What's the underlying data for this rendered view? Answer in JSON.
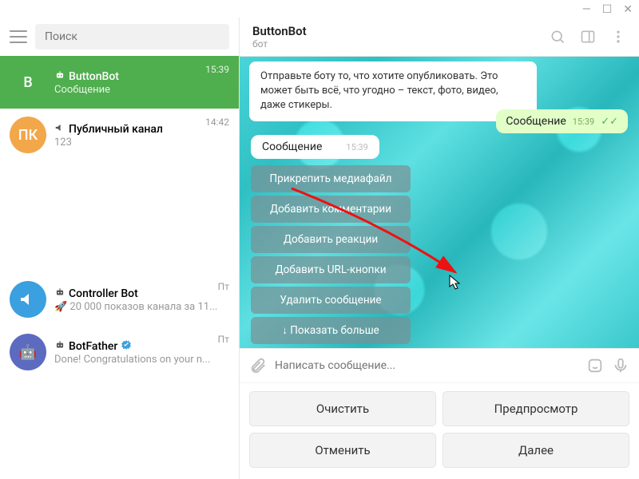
{
  "window": {
    "min": "—",
    "max": "☐",
    "close": "✕"
  },
  "search": {
    "placeholder": "Поиск"
  },
  "chats": [
    {
      "avatar": "В",
      "avatarColor": "#4fae4e",
      "name": "ButtonBot",
      "sub": "Сообщение",
      "time": "15:39",
      "active": true,
      "bot": true
    },
    {
      "avatar": "ПК",
      "avatarColor": "#f2a74b",
      "name": "Публичный канал",
      "sub": "123",
      "time": "14:42",
      "active": false,
      "channel": true
    },
    {
      "avatar": "📣",
      "avatarColor": "#3aa0e0",
      "name": "Controller Bot",
      "sub": "🚀 20 000 показов канала за 11...",
      "time": "Пт",
      "active": false,
      "bot": true
    },
    {
      "avatar": "👤",
      "avatarColor": "#5c6bc0",
      "name": "BotFather",
      "sub": "Done! Congratulations on your n...",
      "time": "Пт",
      "active": false,
      "bot": true,
      "verified": true
    }
  ],
  "header": {
    "title": "ButtonBot",
    "sub": "бот"
  },
  "intro": "Отправьте боту то, что хотите опубликовать. Это может быть всё, что угодно – текст, фото, видео, даже стикеры.",
  "msgOut": {
    "text": "Сообщение",
    "time": "15:39"
  },
  "msgIn": {
    "text": "Сообщение",
    "time": "15:39"
  },
  "keyboard": [
    "Прикрепить медиафайл",
    "Добавить комментарии",
    "Добавить реакции",
    "Добавить URL-кнопки",
    "Удалить сообщение",
    "Показать больше"
  ],
  "compose": {
    "placeholder": "Написать сообщение..."
  },
  "actions": {
    "clear": "Очистить",
    "preview": "Предпросмотр",
    "cancel": "Отменить",
    "next": "Далее"
  }
}
